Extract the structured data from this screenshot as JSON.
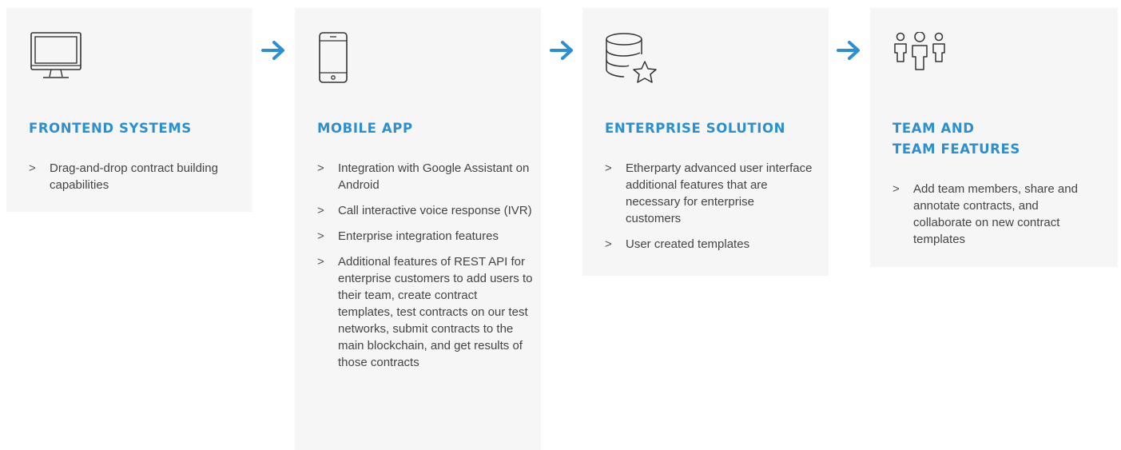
{
  "colors": {
    "accent": "#2b8fd1",
    "card_bg": "#f6f6f6",
    "text": "#444444"
  },
  "columns": [
    {
      "icon": "monitor-icon",
      "title_lines": [
        "FRONTEND SYSTEMS"
      ],
      "items": [
        "Drag-and-drop contract building capabilities"
      ]
    },
    {
      "icon": "smartphone-icon",
      "title_lines": [
        "MOBILE APP"
      ],
      "items": [
        "Integration with Google Assistant on Android",
        "Call interactive voice response (IVR)",
        "Enterprise integration features",
        "Additional features of REST API for enterprise customers to add users to their team, create contract templates, test contracts on our test networks, submit contracts to the main blockchain, and get results of those contracts"
      ]
    },
    {
      "icon": "database-star-icon",
      "title_lines": [
        "ENTERPRISE SOLUTION"
      ],
      "items": [
        "Etherparty advanced user interface additional features that are necessary for enterprise customers",
        "User created templates"
      ]
    },
    {
      "icon": "team-icon",
      "title_lines": [
        "TEAM AND",
        "TEAM FEATURES"
      ],
      "items": [
        "Add team members, share and annotate contracts, and collaborate on new contract templates"
      ]
    }
  ],
  "bullet_marker": ">",
  "arrows": [
    "arrow-right-icon",
    "arrow-right-icon",
    "arrow-right-icon"
  ]
}
